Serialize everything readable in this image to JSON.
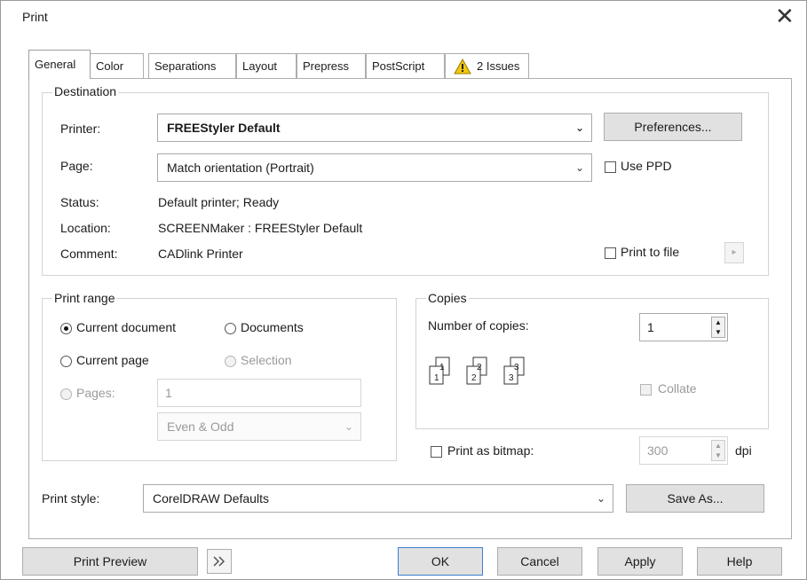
{
  "window": {
    "title": "Print",
    "close_glyph": "✕"
  },
  "tabs": [
    {
      "label": "General"
    },
    {
      "label": "Color"
    },
    {
      "label": "Separations"
    },
    {
      "label": "Layout"
    },
    {
      "label": "Prepress"
    },
    {
      "label": "PostScript"
    },
    {
      "label": "2 Issues",
      "icon": "warning-icon"
    }
  ],
  "destination": {
    "legend": "Destination",
    "printer_label": "Printer:",
    "printer_value": "FREEStyler Default",
    "preferences_label": "Preferences...",
    "page_label": "Page:",
    "page_value": "Match orientation (Portrait)",
    "use_ppd_label": "Use PPD",
    "status_label": "Status:",
    "status_value": "Default printer; Ready",
    "location_label": "Location:",
    "location_value": "SCREENMaker : FREEStyler Default",
    "comment_label": "Comment:",
    "comment_value": "CADlink Printer",
    "print_to_file_label": "Print to file"
  },
  "print_range": {
    "legend": "Print range",
    "current_document": "Current document",
    "documents": "Documents",
    "current_page": "Current page",
    "selection": "Selection",
    "pages_label": "Pages:",
    "pages_value": "1",
    "even_odd_value": "Even & Odd"
  },
  "copies": {
    "legend": "Copies",
    "number_label": "Number of copies:",
    "number_value": "1",
    "collate_label": "Collate",
    "stack_numbers": [
      "1",
      "1",
      "2",
      "2",
      "3",
      "3"
    ]
  },
  "bitmap": {
    "label": "Print as bitmap:",
    "dpi_value": "300",
    "dpi_unit": "dpi"
  },
  "print_style": {
    "label": "Print style:",
    "value": "CorelDRAW Defaults",
    "save_as_label": "Save As..."
  },
  "footer": {
    "print_preview_label": "Print Preview",
    "ok_label": "OK",
    "cancel_label": "Cancel",
    "apply_label": "Apply",
    "help_label": "Help"
  },
  "colors": {
    "warning_yellow": "#f2c80f",
    "button_face": "#e1e1e1",
    "border": "#adadad"
  }
}
